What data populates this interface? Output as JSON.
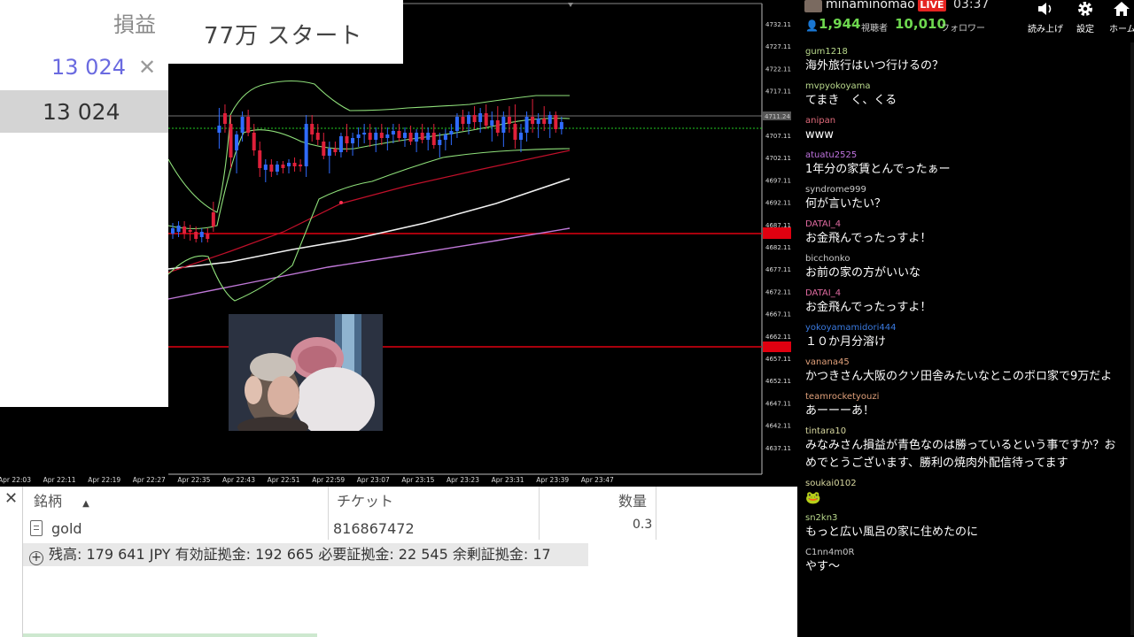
{
  "pnl_panel": {
    "title": "損益",
    "value_blue": "13 024",
    "value_dark": "13 024",
    "close_icon": "close-icon"
  },
  "start_label": "77万 スタート",
  "chart": {
    "price_labels": [
      "4732.11",
      "4727.11",
      "4722.11",
      "4717.11",
      "4712.11",
      "4707.11",
      "4702.11",
      "4697.11",
      "4692.11",
      "4687.11",
      "4682.11",
      "4677.11",
      "4672.11",
      "4667.11",
      "4662.11",
      "4657.11",
      "4652.11",
      "4647.11",
      "4642.11",
      "4637.11"
    ],
    "current_price_label": "4711.24",
    "time_labels": [
      "Apr 22:03",
      "Apr 22:11",
      "Apr 22:19",
      "Apr 22:27",
      "Apr 22:35",
      "Apr 22:43",
      "Apr 22:51",
      "Apr 22:59",
      "Apr 23:07",
      "Apr 23:15",
      "Apr 23:23",
      "Apr 23:31",
      "Apr 23:39",
      "Apr 23:47"
    ],
    "colors": {
      "bull": "#2f6bff",
      "bear": "#e0203a",
      "band": "#8fe07a",
      "ma_white": "#f0f0f0",
      "ma_violet": "#c078d8",
      "ma_red": "#c0102a",
      "level_red": "#e00010",
      "grid": "#9aa"
    }
  },
  "positions": {
    "headers": {
      "symbol": "銘柄",
      "ticket": "チケット",
      "qty": "数量"
    },
    "row": {
      "symbol": "gold",
      "ticket": "816867472",
      "qty": "0.3"
    },
    "balance": "残高: 179 641 JPY  有効証拠金: 192 665  必要証拠金: 22 545  余剰証拠金: 17",
    "icons": {
      "close": "close-icon",
      "sort": "sort-up-icon",
      "doc": "document-icon",
      "plus": "plus-circle-icon"
    }
  },
  "chat": {
    "streamer": "minaminomao",
    "live": "LIVE",
    "time": "03:37",
    "viewers": "1,944",
    "viewers_label": "視聴者",
    "followers": "10,010",
    "followers_label": "フォロワー",
    "buttons": [
      {
        "label": "読み上げ",
        "icon": "speaker-icon"
      },
      {
        "label": "設定",
        "icon": "gear-icon"
      },
      {
        "label": "ホーム",
        "icon": "home-icon"
      }
    ],
    "messages": [
      {
        "user": "gum1218",
        "color": "#b9d98c",
        "text": "海外旅行はいつ行けるの？"
      },
      {
        "user": "mvpyokoyama",
        "color": "#b9d98c",
        "text": "てまき　く、くる"
      },
      {
        "user": "anipan",
        "color": "#e06a7a",
        "text": "www"
      },
      {
        "user": "atuatu2525",
        "color": "#c074e0",
        "text": "1年分の家賃とんでったぁー"
      },
      {
        "user": "syndrome999",
        "color": "#c8c8c8",
        "text": "何が言いたい？"
      },
      {
        "user": "DATAI_4",
        "color": "#e06aa0",
        "text": "お金飛んでったっすよ！"
      },
      {
        "user": "bicchonko",
        "color": "#c8c8c8",
        "text": "お前の家の方がいいな"
      },
      {
        "user": "DATAI_4",
        "color": "#e06aa0",
        "text": "お金飛んでったっすよ！"
      },
      {
        "user": "yokoyamamidori444",
        "color": "#3a7ae0",
        "text": "１０か月分溶け"
      },
      {
        "user": "vanana45",
        "color": "#e0a07a",
        "text": "かつきさん大阪のクソ田舎みたいなとこのボロ家で9万だよ"
      },
      {
        "user": "teamrocketyouzi",
        "color": "#e0a07a",
        "text": "あーーーあ！"
      },
      {
        "user": "tintara10",
        "color": "#d8d8a0",
        "text": "みなみさん損益が青色なのは勝っているという事ですか？おめでとうございます、勝利の焼肉外配信待ってます"
      },
      {
        "user": "soukai0102",
        "color": "#d8d8a0",
        "text": "🐸",
        "emote": true
      },
      {
        "user": "sn2kn3",
        "color": "#b9d98c",
        "text": "もっと広い風呂の家に住めたのに"
      },
      {
        "user": "C1nn4m0R",
        "color": "#c8c8c8",
        "text": "やす～"
      }
    ]
  }
}
